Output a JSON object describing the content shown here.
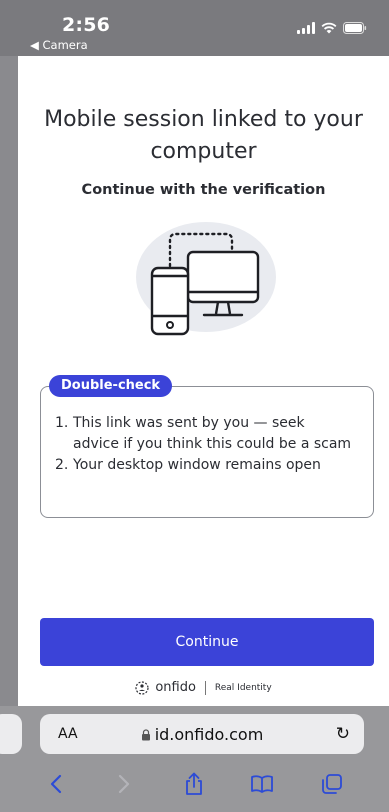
{
  "status_bar": {
    "time": "2:56",
    "back_label": "◀ Camera"
  },
  "page": {
    "title": "Mobile session linked to your computer",
    "subtitle": "Continue with the verification",
    "info_box": {
      "badge": "Double-check",
      "items": [
        {
          "num": "1.",
          "text": "This link was sent by you — seek advice if you think this could be a scam"
        },
        {
          "num": "2.",
          "text": "Your desktop window remains open"
        }
      ]
    },
    "continue_label": "Continue",
    "footer": {
      "brand": "onfido",
      "tagline": "Real Identity"
    }
  },
  "browser": {
    "text_size_label": "AA",
    "url": "id.onfido.com",
    "icons": [
      "back-icon",
      "forward-icon",
      "share-icon",
      "bookmarks-icon",
      "tabs-icon",
      "lock-icon",
      "reload-icon"
    ]
  },
  "colors": {
    "accent": "#3b43d8",
    "text": "#2b2d33",
    "illustration_bg": "#e9ebf0"
  }
}
